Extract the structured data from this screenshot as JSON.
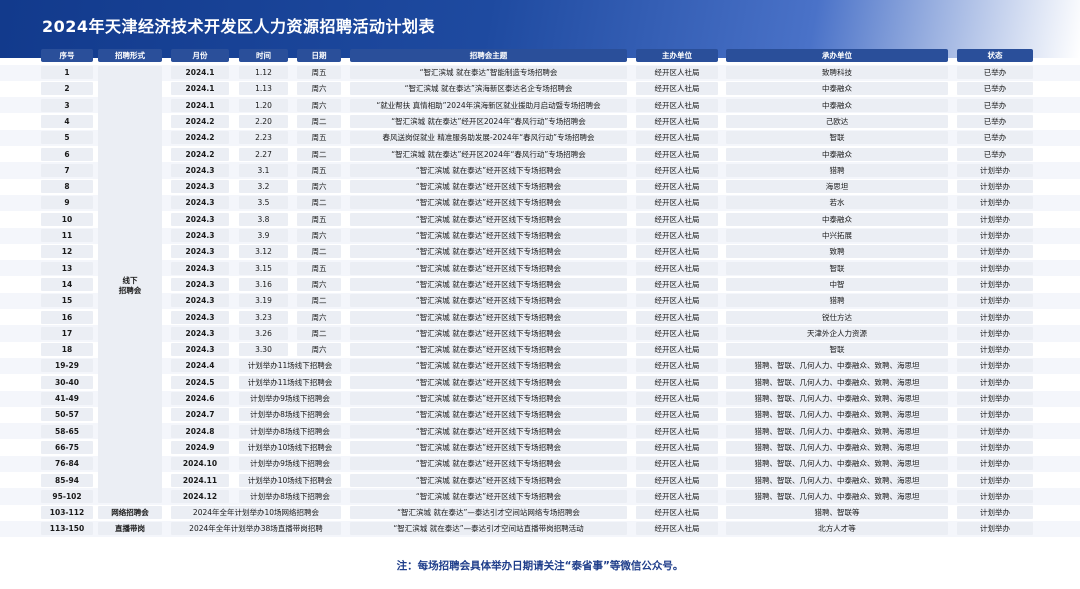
{
  "title": "2024年天津经济技术开发区人力资源招聘活动计划表",
  "headers": [
    "序号",
    "招聘形式",
    "月份",
    "时间",
    "日期",
    "招聘会主题",
    "主办单位",
    "承办单位",
    "状态"
  ],
  "rows": [
    [
      "1",
      "2024.1",
      "1.12",
      "周五",
      "“智汇滨城 就在泰达”智能制造专场招聘会",
      "经开区人社局",
      "致聘科技",
      "已举办"
    ],
    [
      "2",
      "2024.1",
      "1.13",
      "周六",
      "“智汇滨城 就在泰达”滨海新区泰达名企专场招聘会",
      "经开区人社局",
      "中泰融众",
      "已举办"
    ],
    [
      "3",
      "2024.1",
      "1.20",
      "周六",
      "“就业帮扶 真情相助”2024年滨海新区就业援助月启动暨专场招聘会",
      "经开区人社局",
      "中泰融众",
      "已举办"
    ],
    [
      "4",
      "2024.2",
      "2.20",
      "周二",
      "“智汇滨城 就在泰达”经开区2024年“春风行动”专场招聘会",
      "经开区人社局",
      "己欧达",
      "已举办"
    ],
    [
      "5",
      "2024.2",
      "2.23",
      "周五",
      "春风送岗促就业 精准服务助发展-2024年“春风行动”专场招聘会",
      "经开区人社局",
      "智联",
      "已举办"
    ],
    [
      "6",
      "2024.2",
      "2.27",
      "周二",
      "“智汇滨城 就在泰达”经开区2024年“春风行动”专场招聘会",
      "经开区人社局",
      "中泰融众",
      "已举办"
    ],
    [
      "7",
      "2024.3",
      "3.1",
      "周五",
      "“智汇滨城 就在泰达”经开区线下专场招聘会",
      "经开区人社局",
      "猎聘",
      "计划举办"
    ],
    [
      "8",
      "2024.3",
      "3.2",
      "周六",
      "“智汇滨城 就在泰达”经开区线下专场招聘会",
      "经开区人社局",
      "海思坦",
      "计划举办"
    ],
    [
      "9",
      "2024.3",
      "3.5",
      "周二",
      "“智汇滨城 就在泰达”经开区线下专场招聘会",
      "经开区人社局",
      "若水",
      "计划举办"
    ],
    [
      "10",
      "2024.3",
      "3.8",
      "周五",
      "“智汇滨城 就在泰达”经开区线下专场招聘会",
      "经开区人社局",
      "中泰融众",
      "计划举办"
    ],
    [
      "11",
      "2024.3",
      "3.9",
      "周六",
      "“智汇滨城 就在泰达”经开区线下专场招聘会",
      "经开区人社局",
      "中兴拓展",
      "计划举办"
    ],
    [
      "12",
      "2024.3",
      "3.12",
      "周二",
      "“智汇滨城 就在泰达”经开区线下专场招聘会",
      "经开区人社局",
      "致聘",
      "计划举办"
    ],
    [
      "13",
      "2024.3",
      "3.15",
      "周五",
      "“智汇滨城 就在泰达”经开区线下专场招聘会",
      "经开区人社局",
      "智联",
      "计划举办"
    ],
    [
      "14",
      "2024.3",
      "3.16",
      "周六",
      "“智汇滨城 就在泰达”经开区线下专场招聘会",
      "经开区人社局",
      "中智",
      "计划举办"
    ],
    [
      "15",
      "2024.3",
      "3.19",
      "周二",
      "“智汇滨城 就在泰达”经开区线下专场招聘会",
      "经开区人社局",
      "猎聘",
      "计划举办"
    ],
    [
      "16",
      "2024.3",
      "3.23",
      "周六",
      "“智汇滨城 就在泰达”经开区线下专场招聘会",
      "经开区人社局",
      "锐仕方达",
      "计划举办"
    ],
    [
      "17",
      "2024.3",
      "3.26",
      "周二",
      "“智汇滨城 就在泰达”经开区线下专场招聘会",
      "经开区人社局",
      "天津外企人力资源",
      "计划举办"
    ],
    [
      "18",
      "2024.3",
      "3.30",
      "周六",
      "“智汇滨城 就在泰达”经开区线下专场招聘会",
      "经开区人社局",
      "智联",
      "计划举办"
    ]
  ],
  "merged_form": "线下招聘会",
  "merged_form_lines": [
    "线下",
    "招聘会"
  ],
  "plan_rows": [
    [
      "19-29",
      "2024.4",
      "计划举办11场线下招聘会",
      "“智汇滨城 就在泰达”经开区线下专场招聘会",
      "经开区人社局",
      "猎聘、智联、几何人力、中泰融众、致聘、海思坦",
      "计划举办"
    ],
    [
      "30-40",
      "2024.5",
      "计划举办11场线下招聘会",
      "“智汇滨城 就在泰达”经开区线下专场招聘会",
      "经开区人社局",
      "猎聘、智联、几何人力、中泰融众、致聘、海思坦",
      "计划举办"
    ],
    [
      "41-49",
      "2024.6",
      "计划举办9场线下招聘会",
      "“智汇滨城 就在泰达”经开区线下专场招聘会",
      "经开区人社局",
      "猎聘、智联、几何人力、中泰融众、致聘、海思坦",
      "计划举办"
    ],
    [
      "50-57",
      "2024.7",
      "计划举办8场线下招聘会",
      "“智汇滨城 就在泰达”经开区线下专场招聘会",
      "经开区人社局",
      "猎聘、智联、几何人力、中泰融众、致聘、海思坦",
      "计划举办"
    ],
    [
      "58-65",
      "2024.8",
      "计划举办8场线下招聘会",
      "“智汇滨城 就在泰达”经开区线下专场招聘会",
      "经开区人社局",
      "猎聘、智联、几何人力、中泰融众、致聘、海思坦",
      "计划举办"
    ],
    [
      "66-75",
      "2024.9",
      "计划举办10场线下招聘会",
      "“智汇滨城 就在泰达”经开区线下专场招聘会",
      "经开区人社局",
      "猎聘、智联、几何人力、中泰融众、致聘、海思坦",
      "计划举办"
    ],
    [
      "76-84",
      "2024.10",
      "计划举办9场线下招聘会",
      "“智汇滨城 就在泰达”经开区线下专场招聘会",
      "经开区人社局",
      "猎聘、智联、几何人力、中泰融众、致聘、海思坦",
      "计划举办"
    ],
    [
      "85-94",
      "2024.11",
      "计划举办10场线下招聘会",
      "“智汇滨城 就在泰达”经开区线下专场招聘会",
      "经开区人社局",
      "猎聘、智联、几何人力、中泰融众、致聘、海思坦",
      "计划举办"
    ],
    [
      "95-102",
      "2024.12",
      "计划举办8场线下招聘会",
      "“智汇滨城 就在泰达”经开区线下专场招聘会",
      "经开区人社局",
      "猎聘、智联、几何人力、中泰融众、致聘、海思坦",
      "计划举办"
    ]
  ],
  "extra_rows": [
    [
      "103-112",
      "网络招聘会",
      "2024年全年计划举办10场网络招聘会",
      "“智汇滨城 就在泰达”—泰达引才空间站网络专场招聘会",
      "经开区人社局",
      "猎聘、智联等",
      "计划举办"
    ],
    [
      "113-150",
      "直播带岗",
      "2024年全年计划举办38场直播带岗招聘",
      "“智汇滨城 就在泰达”—泰达引才空间站直播带岗招聘活动",
      "经开区人社局",
      "北方人才等",
      "计划举办"
    ]
  ],
  "footnote": "注：每场招聘会具体举办日期请关注“泰省事”等微信公众号。"
}
